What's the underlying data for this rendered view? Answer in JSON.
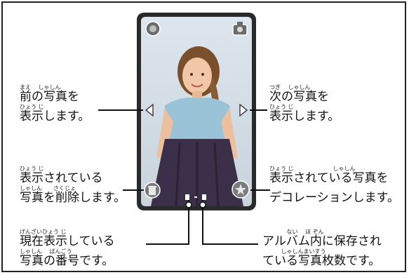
{
  "annotations": {
    "prev_photo": {
      "line1_ruby": "まえ　 しゃしん",
      "line1": "前の写真を",
      "line2_ruby": "ひょう じ",
      "line2": "表示します。"
    },
    "next_photo": {
      "line1_ruby": "つぎ　 しゃしん",
      "line1": "次の写真を",
      "line2_ruby": "ひょう じ",
      "line2": "表示します。"
    },
    "delete_photo": {
      "line1_ruby": "ひょう じ",
      "line1": "表示されている",
      "line2_ruby": "しゃしん　　さくじょ",
      "line2": "写真を削除します。"
    },
    "decorate_photo": {
      "line1_ruby": "ひょう じ　　　　　　　しゃしん",
      "line1": "表示されている写真を",
      "line2": "デコレーションします。"
    },
    "photo_number": {
      "line1_ruby": "げんざいひょう じ",
      "line1": "現在表示している",
      "line2_ruby": "しゃしん　 ばんごう",
      "line2": "写真の番号です。"
    },
    "photo_count": {
      "line1_ruby": "　　　　 ない　 ほ ぞん",
      "line1": "アルバム内に保存され",
      "line2_ruby": "　　　 しゃしんまいすう",
      "line2": "ている写真枚数です。"
    }
  },
  "colors": {
    "line": "#111111",
    "device_body": "#2a2a2a",
    "dress": "#3b2f49"
  }
}
